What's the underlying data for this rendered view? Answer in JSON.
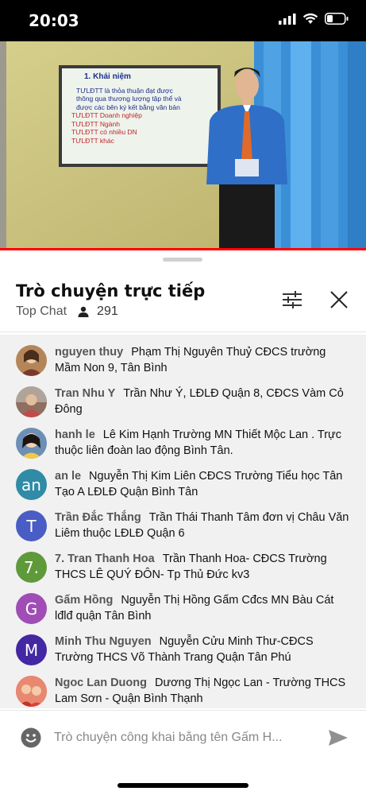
{
  "status": {
    "time": "20:03"
  },
  "video": {
    "slide_title": "1. Khái niệm",
    "slide_lines": [
      "TƯLĐTT là thỏa thuận đạt được",
      "thông qua thương lượng tập thể và",
      "được các bên ký kết bằng văn bản",
      "TƯLĐTT Doanh nghiệp",
      "TƯLĐTT Ngành",
      "TƯLĐTT có nhiều DN",
      "TƯLĐTT khác"
    ],
    "progress": 1.0,
    "progress_color": "#ff0000"
  },
  "chat": {
    "title": "Trò chuyện trực tiếp",
    "mode": "Top Chat",
    "viewer_count": "291",
    "filter_icon": "sliders-icon",
    "close_icon": "close-icon",
    "messages": [
      {
        "author": "nguyen thuy",
        "text": "Phạm Thị Nguyên Thuỷ CĐCS trường Mầm Non 9, Tân Bình",
        "avatar": "photo",
        "avatar_color": "#b5855a"
      },
      {
        "author": "Tran Nhu Y",
        "text": "Trần Như Ý, LĐLĐ Quận 8, CĐCS Vàm Cỏ Đông",
        "avatar": "photo",
        "avatar_color": "#8f6f60"
      },
      {
        "author": "hanh le",
        "text": "Lê Kim Hạnh Trường MN Thiết Mộc Lan . Trực thuộc liên đoàn lao động Bình Tân.",
        "avatar": "photo",
        "avatar_color": "#6c8fb5"
      },
      {
        "author": "an le",
        "text": "Nguyễn Thị Kim Liên CĐCS Trường Tiểu học Tân Tạo A LĐLĐ Quận Bình Tân",
        "avatar": "an",
        "avatar_color": "#2f8ba6"
      },
      {
        "author": "Trần Đắc Thắng",
        "text": "Trần Thái Thanh Tâm đơn vị Châu Văn Liêm thuộc LĐLĐ Quận 6",
        "avatar": "T",
        "avatar_color": "#4a5dc4"
      },
      {
        "author": "7. Tran Thanh Hoa",
        "text": "Trần Thanh Hoa- CĐCS Trường THCS LÊ QUÝ ĐÔN- Tp Thủ Đức kv3",
        "avatar": "7.",
        "avatar_color": "#5f9a3a"
      },
      {
        "author": "Gấm Hồng",
        "text": "Nguyễn Thị Hồng Gấm Cđcs MN Bàu Cát lđlđ quận Tân Bình",
        "avatar": "G",
        "avatar_color": "#a04db6"
      },
      {
        "author": "Minh Thu Nguyen",
        "text": "Nguyễn Cửu Minh Thư-CĐCS Trường THCS Võ Thành Trang Quận Tân Phú",
        "avatar": "M",
        "avatar_color": "#4327a3"
      },
      {
        "author": "Ngoc Lan Duong",
        "text": "Dương Thị Ngọc Lan - Trường THCS Lam Sơn - Quận Bình Thạnh",
        "avatar": "photo",
        "avatar_color": "#d9614a"
      }
    ]
  },
  "composer": {
    "placeholder": "Trò chuyện công khai bằng tên Gấm H...",
    "emoji_icon": "emoji-icon",
    "send_icon": "send-icon"
  }
}
